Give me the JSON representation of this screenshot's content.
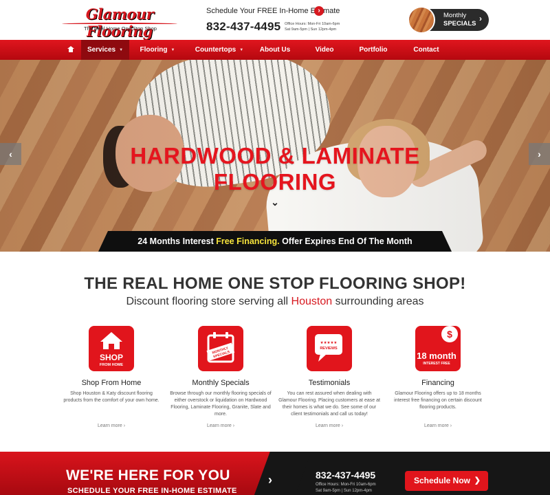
{
  "header": {
    "logo_text": "Glamour Flooring",
    "logo_tagline": "The Real Home One Stop Shop",
    "estimate_text": "Schedule Your FREE In-Home Estimate",
    "phone": "832-437-4495",
    "hours_line1": "Office Hours: Mon-Fri 10am-6pm",
    "hours_line2": "Sat 9am-5pm   |   Sun 12pm-4pm",
    "specials_line1": "Monthly",
    "specials_line2": "SPECIALS"
  },
  "nav": {
    "items": [
      {
        "label": "Services"
      },
      {
        "label": "Flooring"
      },
      {
        "label": "Countertops"
      },
      {
        "label": "About Us"
      },
      {
        "label": "Video"
      },
      {
        "label": "Portfolio"
      },
      {
        "label": "Contact"
      }
    ],
    "active": "Services"
  },
  "hero": {
    "title_line1": "HARDWOOD & LAMINATE",
    "title_line2": "FLOORING",
    "banner_pre": "24 Months Interest ",
    "banner_highlight": "Free Financing.",
    "banner_post": " Offer Expires End Of The Month"
  },
  "intro": {
    "heading": "THE REAL HOME ONE STOP FLOORING SHOP!",
    "sub_pre": "Discount flooring store serving all ",
    "sub_highlight": "Houston",
    "sub_post": " surrounding areas"
  },
  "features": [
    {
      "icon": "shop-from-home-icon",
      "icon_text1": "SHOP",
      "icon_text2": "FROM HOME",
      "title": "Shop From Home",
      "desc": "Shop Houston & Katy discount flooring products from the comfort of your own home.",
      "more": "Learn more"
    },
    {
      "icon": "calendar-icon",
      "icon_text1": "MONTHLY",
      "icon_text2": "SPECIALS",
      "title": "Monthly Specials",
      "desc": "Browse through our monthly flooring specials of either overstock or liquidation on Hardwood Flooring, Laminate Flooring, Granite, Slate and more.",
      "more": "Learn more"
    },
    {
      "icon": "reviews-icon",
      "icon_text1": "★★★★★",
      "icon_text2": "REVIEWS",
      "title": "Testimonials",
      "desc": "You can rest assured when dealing with Glamour Flooring. Placing customers at ease at their homes is what we do. See some of our client testimonials and call us today!",
      "more": "Learn more"
    },
    {
      "icon": "financing-icon",
      "icon_text1": "18 month",
      "icon_text2": "INTEREST FREE",
      "title": "Financing",
      "desc": "Glamour Flooring offers up to 18 months interest free financing on certain discount flooring products.",
      "more": "Learn more"
    }
  ],
  "cta": {
    "heading": "WE'RE HERE FOR YOU",
    "sub": "SCHEDULE YOUR FREE IN-HOME ESTIMATE",
    "phone": "832-437-4495",
    "hours_line1": "Office Hours: Mon-Fri 10am-6pm",
    "hours_line2": "Sat 9am-5pm   |   Sun 12pm-4pm",
    "button": "Schedule Now"
  },
  "colors": {
    "brand_red": "#e1151c",
    "dark": "#161616",
    "highlight_yellow": "#f7e43c"
  }
}
